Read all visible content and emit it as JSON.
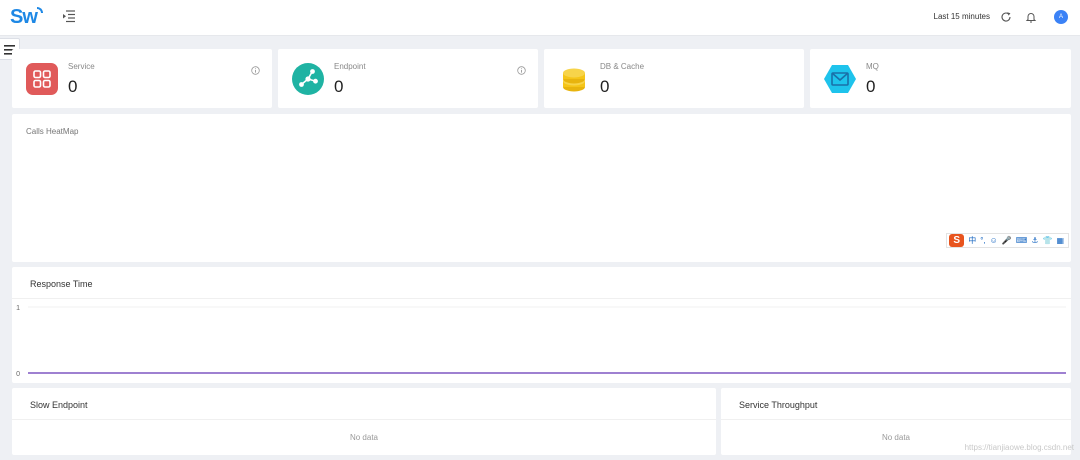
{
  "header": {
    "logo_text": "Sw",
    "time_range": "Last 15 minutes",
    "avatar_initial": "A"
  },
  "stats": [
    {
      "label": "Service",
      "value": "0",
      "icon": "grid-icon",
      "color": "#e05a5a"
    },
    {
      "label": "Endpoint",
      "value": "0",
      "icon": "endpoint-icon",
      "color": "#1fb3a3"
    },
    {
      "label": "DB & Cache",
      "value": "0",
      "icon": "database-icon",
      "color": "#f5c518"
    },
    {
      "label": "MQ",
      "value": "0",
      "icon": "message-queue-icon",
      "color": "#1ec3ec"
    }
  ],
  "heatmap": {
    "title": "Calls HeatMap"
  },
  "ime_toolbar": {
    "logo": "S",
    "tools": [
      "中",
      "°,",
      "☺",
      "🎤",
      "⌨",
      "⚓",
      "👕",
      "▦"
    ]
  },
  "response_time": {
    "title": "Response Time",
    "chart_data": {
      "type": "line",
      "title": "Response Time",
      "y_ticks": [
        "1",
        "0"
      ],
      "ylim": [
        0,
        1
      ],
      "series": [
        {
          "values": [
            0,
            0
          ],
          "color": "#7e57c2"
        }
      ],
      "grid": true
    }
  },
  "slow_endpoint": {
    "title": "Slow Endpoint",
    "empty_text": "No data"
  },
  "service_throughput": {
    "title": "Service Throughput",
    "empty_text": "No data"
  },
  "watermark": "https://tianjiaowe.blog.csdn.net"
}
